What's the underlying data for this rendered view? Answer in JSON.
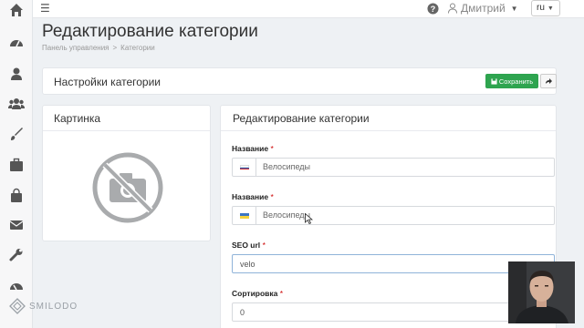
{
  "topbar": {
    "menu_icon": "hamburger-icon",
    "help_icon": "question-circle-icon",
    "user_name": "Дмитрий",
    "language": "ru"
  },
  "sidebar": {
    "icons": [
      "home-icon",
      "dashboard-icon",
      "user-icon",
      "users-icon",
      "brush-icon",
      "briefcase-icon",
      "shopping-bag-icon",
      "envelope-icon",
      "wrench-icon",
      "tachometer-icon"
    ]
  },
  "page": {
    "title": "Редактирование категории",
    "breadcrumb": [
      "Панель управления",
      "Категории"
    ],
    "breadcrumb_separator": ">"
  },
  "settings": {
    "title": "Настройки категории",
    "save_label": "Сохранить"
  },
  "picture": {
    "title": "Картинка"
  },
  "edit": {
    "title": "Редактирование категории",
    "fields": [
      {
        "label": "Название",
        "required": "*",
        "flag": "ru",
        "value": "Велосипеды"
      },
      {
        "label": "Название",
        "required": "*",
        "flag": "ua",
        "value": "Велосипеды"
      },
      {
        "label": "SEO url",
        "required": "*",
        "value": "velo"
      },
      {
        "label": "Сортировка",
        "required": "*",
        "value": "0"
      }
    ]
  },
  "brand": {
    "logo_text": "SMILODO"
  },
  "colors": {
    "save_button": "#2ea44f",
    "required_mark": "#cc0000",
    "focus_border": "#8fb3d9"
  }
}
